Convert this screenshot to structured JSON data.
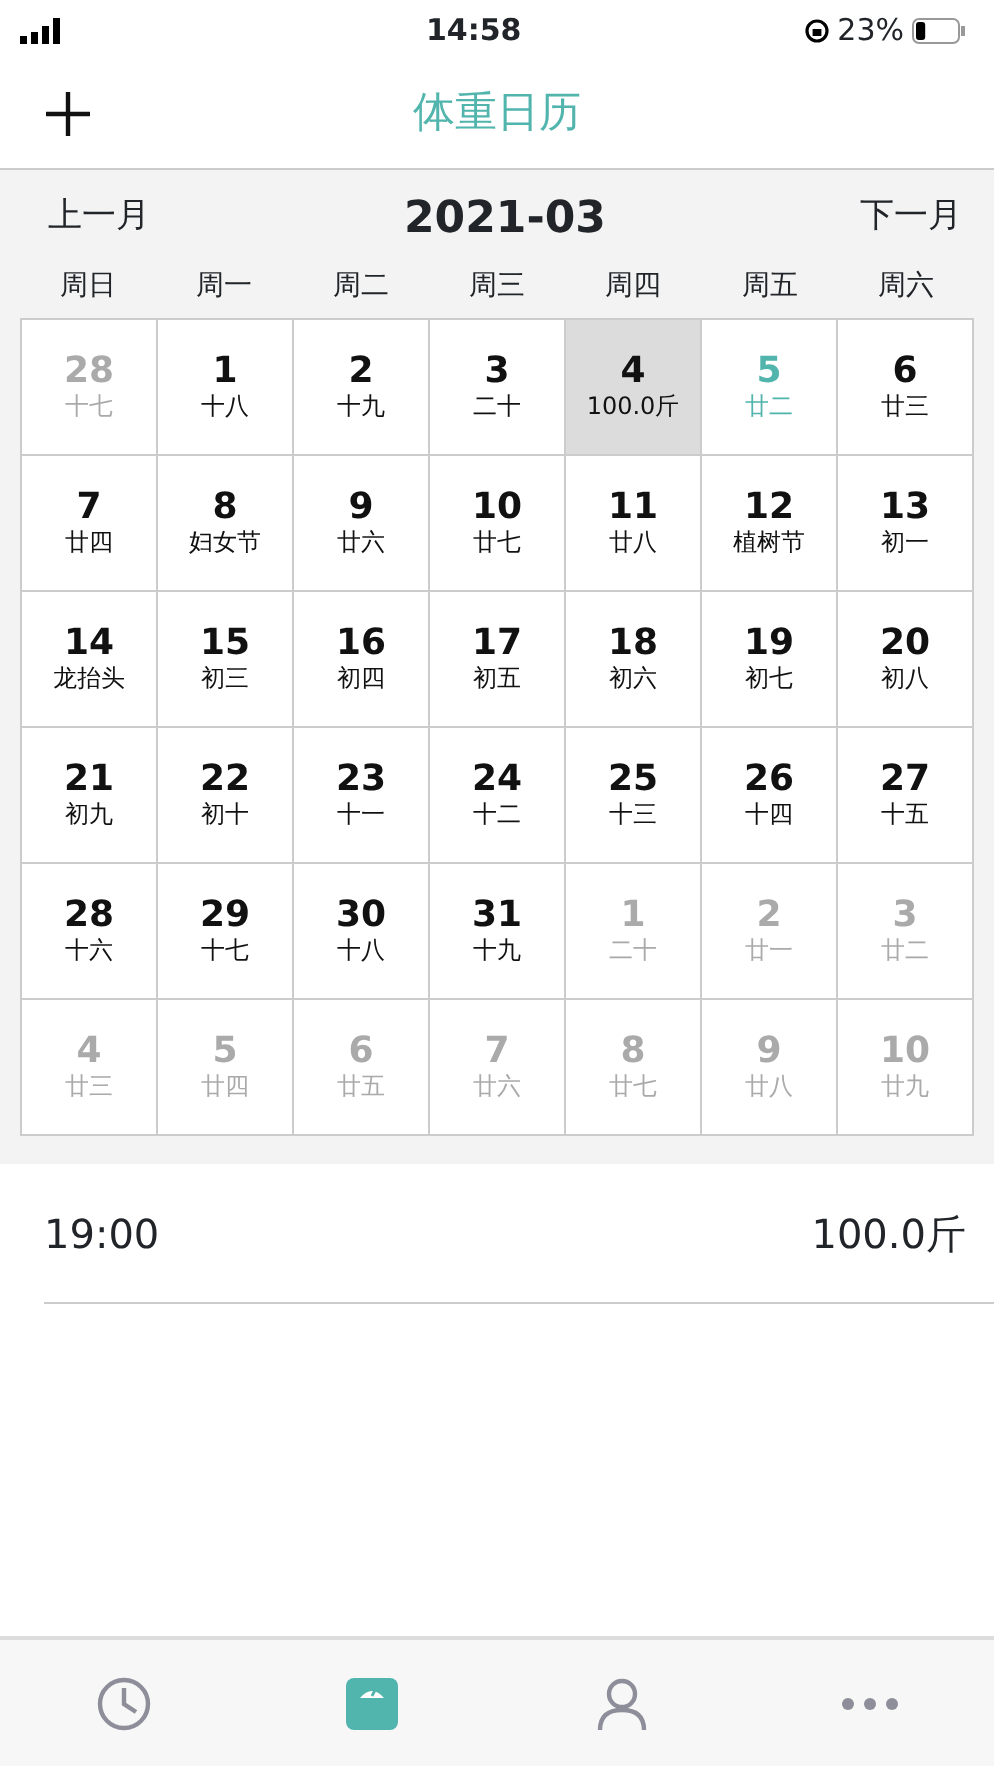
{
  "status_bar": {
    "time": "14:58",
    "battery": "23%"
  },
  "header": {
    "title": "体重日历"
  },
  "month_nav": {
    "prev": "上一月",
    "title": "2021-03",
    "next": "下一月"
  },
  "weekdays": [
    "周日",
    "周一",
    "周二",
    "周三",
    "周四",
    "周五",
    "周六"
  ],
  "days": [
    {
      "day": "28",
      "sub": "十七",
      "in_month": false,
      "selected": false,
      "today": false
    },
    {
      "day": "1",
      "sub": "十八",
      "in_month": true,
      "selected": false,
      "today": false
    },
    {
      "day": "2",
      "sub": "十九",
      "in_month": true,
      "selected": false,
      "today": false
    },
    {
      "day": "3",
      "sub": "二十",
      "in_month": true,
      "selected": false,
      "today": false
    },
    {
      "day": "4",
      "sub": "100.0斤",
      "in_month": true,
      "selected": true,
      "today": false
    },
    {
      "day": "5",
      "sub": "廿二",
      "in_month": true,
      "selected": false,
      "today": true
    },
    {
      "day": "6",
      "sub": "廿三",
      "in_month": true,
      "selected": false,
      "today": false
    },
    {
      "day": "7",
      "sub": "廿四",
      "in_month": true,
      "selected": false,
      "today": false
    },
    {
      "day": "8",
      "sub": "妇女节",
      "in_month": true,
      "selected": false,
      "today": false
    },
    {
      "day": "9",
      "sub": "廿六",
      "in_month": true,
      "selected": false,
      "today": false
    },
    {
      "day": "10",
      "sub": "廿七",
      "in_month": true,
      "selected": false,
      "today": false
    },
    {
      "day": "11",
      "sub": "廿八",
      "in_month": true,
      "selected": false,
      "today": false
    },
    {
      "day": "12",
      "sub": "植树节",
      "in_month": true,
      "selected": false,
      "today": false
    },
    {
      "day": "13",
      "sub": "初一",
      "in_month": true,
      "selected": false,
      "today": false
    },
    {
      "day": "14",
      "sub": "龙抬头",
      "in_month": true,
      "selected": false,
      "today": false
    },
    {
      "day": "15",
      "sub": "初三",
      "in_month": true,
      "selected": false,
      "today": false
    },
    {
      "day": "16",
      "sub": "初四",
      "in_month": true,
      "selected": false,
      "today": false
    },
    {
      "day": "17",
      "sub": "初五",
      "in_month": true,
      "selected": false,
      "today": false
    },
    {
      "day": "18",
      "sub": "初六",
      "in_month": true,
      "selected": false,
      "today": false
    },
    {
      "day": "19",
      "sub": "初七",
      "in_month": true,
      "selected": false,
      "today": false
    },
    {
      "day": "20",
      "sub": "初八",
      "in_month": true,
      "selected": false,
      "today": false
    },
    {
      "day": "21",
      "sub": "初九",
      "in_month": true,
      "selected": false,
      "today": false
    },
    {
      "day": "22",
      "sub": "初十",
      "in_month": true,
      "selected": false,
      "today": false
    },
    {
      "day": "23",
      "sub": "十一",
      "in_month": true,
      "selected": false,
      "today": false
    },
    {
      "day": "24",
      "sub": "十二",
      "in_month": true,
      "selected": false,
      "today": false
    },
    {
      "day": "25",
      "sub": "十三",
      "in_month": true,
      "selected": false,
      "today": false
    },
    {
      "day": "26",
      "sub": "十四",
      "in_month": true,
      "selected": false,
      "today": false
    },
    {
      "day": "27",
      "sub": "十五",
      "in_month": true,
      "selected": false,
      "today": false
    },
    {
      "day": "28",
      "sub": "十六",
      "in_month": true,
      "selected": false,
      "today": false
    },
    {
      "day": "29",
      "sub": "十七",
      "in_month": true,
      "selected": false,
      "today": false
    },
    {
      "day": "30",
      "sub": "十八",
      "in_month": true,
      "selected": false,
      "today": false
    },
    {
      "day": "31",
      "sub": "十九",
      "in_month": true,
      "selected": false,
      "today": false
    },
    {
      "day": "1",
      "sub": "二十",
      "in_month": false,
      "selected": false,
      "today": false
    },
    {
      "day": "2",
      "sub": "廿一",
      "in_month": false,
      "selected": false,
      "today": false
    },
    {
      "day": "3",
      "sub": "廿二",
      "in_month": false,
      "selected": false,
      "today": false
    },
    {
      "day": "4",
      "sub": "廿三",
      "in_month": false,
      "selected": false,
      "today": false
    },
    {
      "day": "5",
      "sub": "廿四",
      "in_month": false,
      "selected": false,
      "today": false
    },
    {
      "day": "6",
      "sub": "廿五",
      "in_month": false,
      "selected": false,
      "today": false
    },
    {
      "day": "7",
      "sub": "廿六",
      "in_month": false,
      "selected": false,
      "today": false
    },
    {
      "day": "8",
      "sub": "廿七",
      "in_month": false,
      "selected": false,
      "today": false
    },
    {
      "day": "9",
      "sub": "廿八",
      "in_month": false,
      "selected": false,
      "today": false
    },
    {
      "day": "10",
      "sub": "廿九",
      "in_month": false,
      "selected": false,
      "today": false
    }
  ],
  "records": [
    {
      "time": "19:00",
      "weight": "100.0斤"
    }
  ],
  "tabs": [
    {
      "kind": "history",
      "selected": false
    },
    {
      "kind": "scale",
      "selected": true
    },
    {
      "kind": "profile",
      "selected": false
    },
    {
      "kind": "more",
      "selected": false
    }
  ]
}
